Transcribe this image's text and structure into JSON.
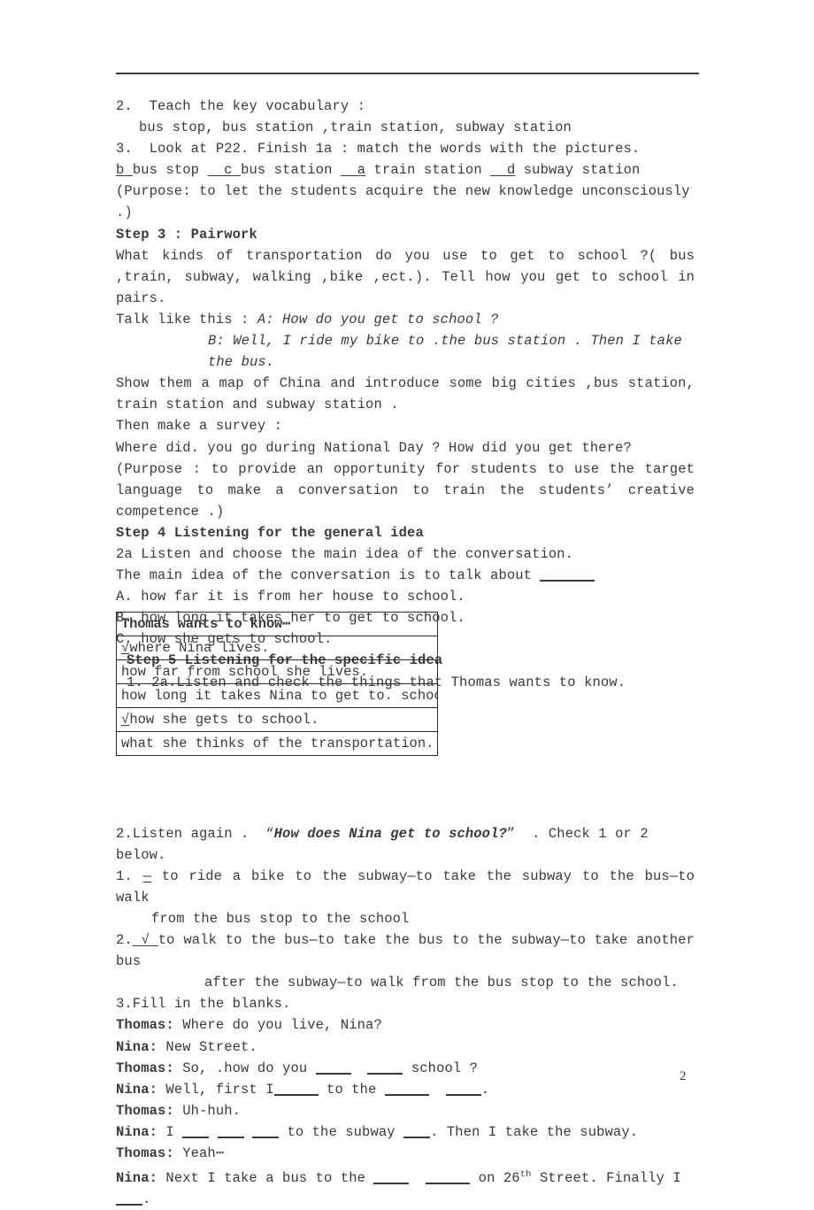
{
  "page": {
    "number": "2"
  },
  "body": {
    "l1_num": "2.",
    "l1_text": "Teach the key vocabulary :",
    "l2_text": "bus stop, bus station ,train station, subway station",
    "l3_num": "3.",
    "l3_text": "Look at P22. Finish 1a : match the words with the pictures.",
    "match": {
      "a1": "b",
      "t1": "bus stop",
      "a2": "c",
      "t2": "bus station",
      "a3": "a",
      "t3": "train station",
      "a4": "d",
      "t4": "subway station"
    },
    "purpose1": "(Purpose: to let the students acquire the new knowledge unconsciously .)",
    "step3_heading": "Step 3 : Pairwork",
    "step3_p1": "What kinds of transportation do you use to get to school ?( bus ,train, subway, walking ,bike ,ect.). Tell how you get to school in pairs.",
    "talk_lead": "Talk like this : ",
    "talk_a": "A: How do you get to school ?",
    "talk_b": "B: Well, I ride my bike to .the bus station . Then I take the bus.",
    "show_map": "Show them a map of China and introduce some big cities ,bus station, train station and subway station .",
    "survey_lead": "Then make a survey :",
    "survey_q": "Where did. you go during National Day ? How did you get there?",
    "purpose2": "(Purpose : to provide an opportunity for students to use the target language to make a conversation to train the students’  creative competence .)",
    "step4_heading": "Step 4 Listening for the general idea",
    "step4_2a": "2a Listen and choose the main idea of the conversation.",
    "step4_stem": "The main idea of the conversation is to talk about ",
    "step4_a": "A. how far it is from her house to school.",
    "step4_b": "B. how long it takes her to get to school.",
    "step4_c": "C. how she gets to school.",
    "step5_heading": "Step 5 Listening for the specific idea",
    "step5_1": "1. 2a.Listen and check the things that Thomas wants to know.",
    "listen_again_pre": "2.Listen again .  “",
    "listen_again_ital": "How does Nina get to school?",
    "listen_again_post": "”  . Check 1 or 2 below.",
    "opt1_num": "1.",
    "opt1_dash": "—",
    "opt1_text": "to ride a bike to the subway—to take the subway to the bus—to walk",
    "opt1_cont": "from the bus stop to the school",
    "opt2_num": "2.",
    "opt2_tick": "√",
    "opt2_text": "to walk to the bus—to take the bus to the subway—to take another bus",
    "opt2_cont": "after the subway—to walk from the bus stop to the school.",
    "fill_heading": "3.Fill in the blanks."
  },
  "table": {
    "header": "Thomas wants to know⋯",
    "rows": [
      {
        "tick": "√",
        "text": "where Nina lives."
      },
      {
        "tick": "",
        "text": "how far from school she lives."
      },
      {
        "tick": "",
        "text": "how long it takes Nina to get to. school."
      },
      {
        "tick": "√",
        "text": "how she gets to school."
      },
      {
        "tick": "",
        "text": "what she thinks of the transportation."
      }
    ]
  },
  "dialogue": {
    "d1_speaker": "Thomas:",
    "d1_text": "Where do you live, Nina?",
    "d2_speaker": "Nina:",
    "d2_text": "New Street.",
    "d3_speaker": "Thomas:",
    "d3_pre": "So, .how do you ",
    "d3_mid": " ",
    "d3_post": " school ?",
    "d4_speaker": "Nina:",
    "d4_pre": "Well, first I",
    "d4_mid": " to the ",
    "d4_post": " ",
    "d4_end": ".",
    "d5_speaker": "Thomas:",
    "d5_text": "Uh-huh.",
    "d6_speaker": "Nina:",
    "d6_pre": "I ",
    "d6_mid": " to the subway ",
    "d6_post": ". Then I take the subway.",
    "d7_speaker": "Thomas:",
    "d7_text": "Yeah⋯",
    "d8_speaker": "Nina:",
    "d8_pre": "Next I take a bus to the ",
    "d8_mid": " ",
    "d8_on": " on 26",
    "d8_sup": "th",
    "d8_post": " Street. Finally I ",
    "d8_end": "."
  }
}
